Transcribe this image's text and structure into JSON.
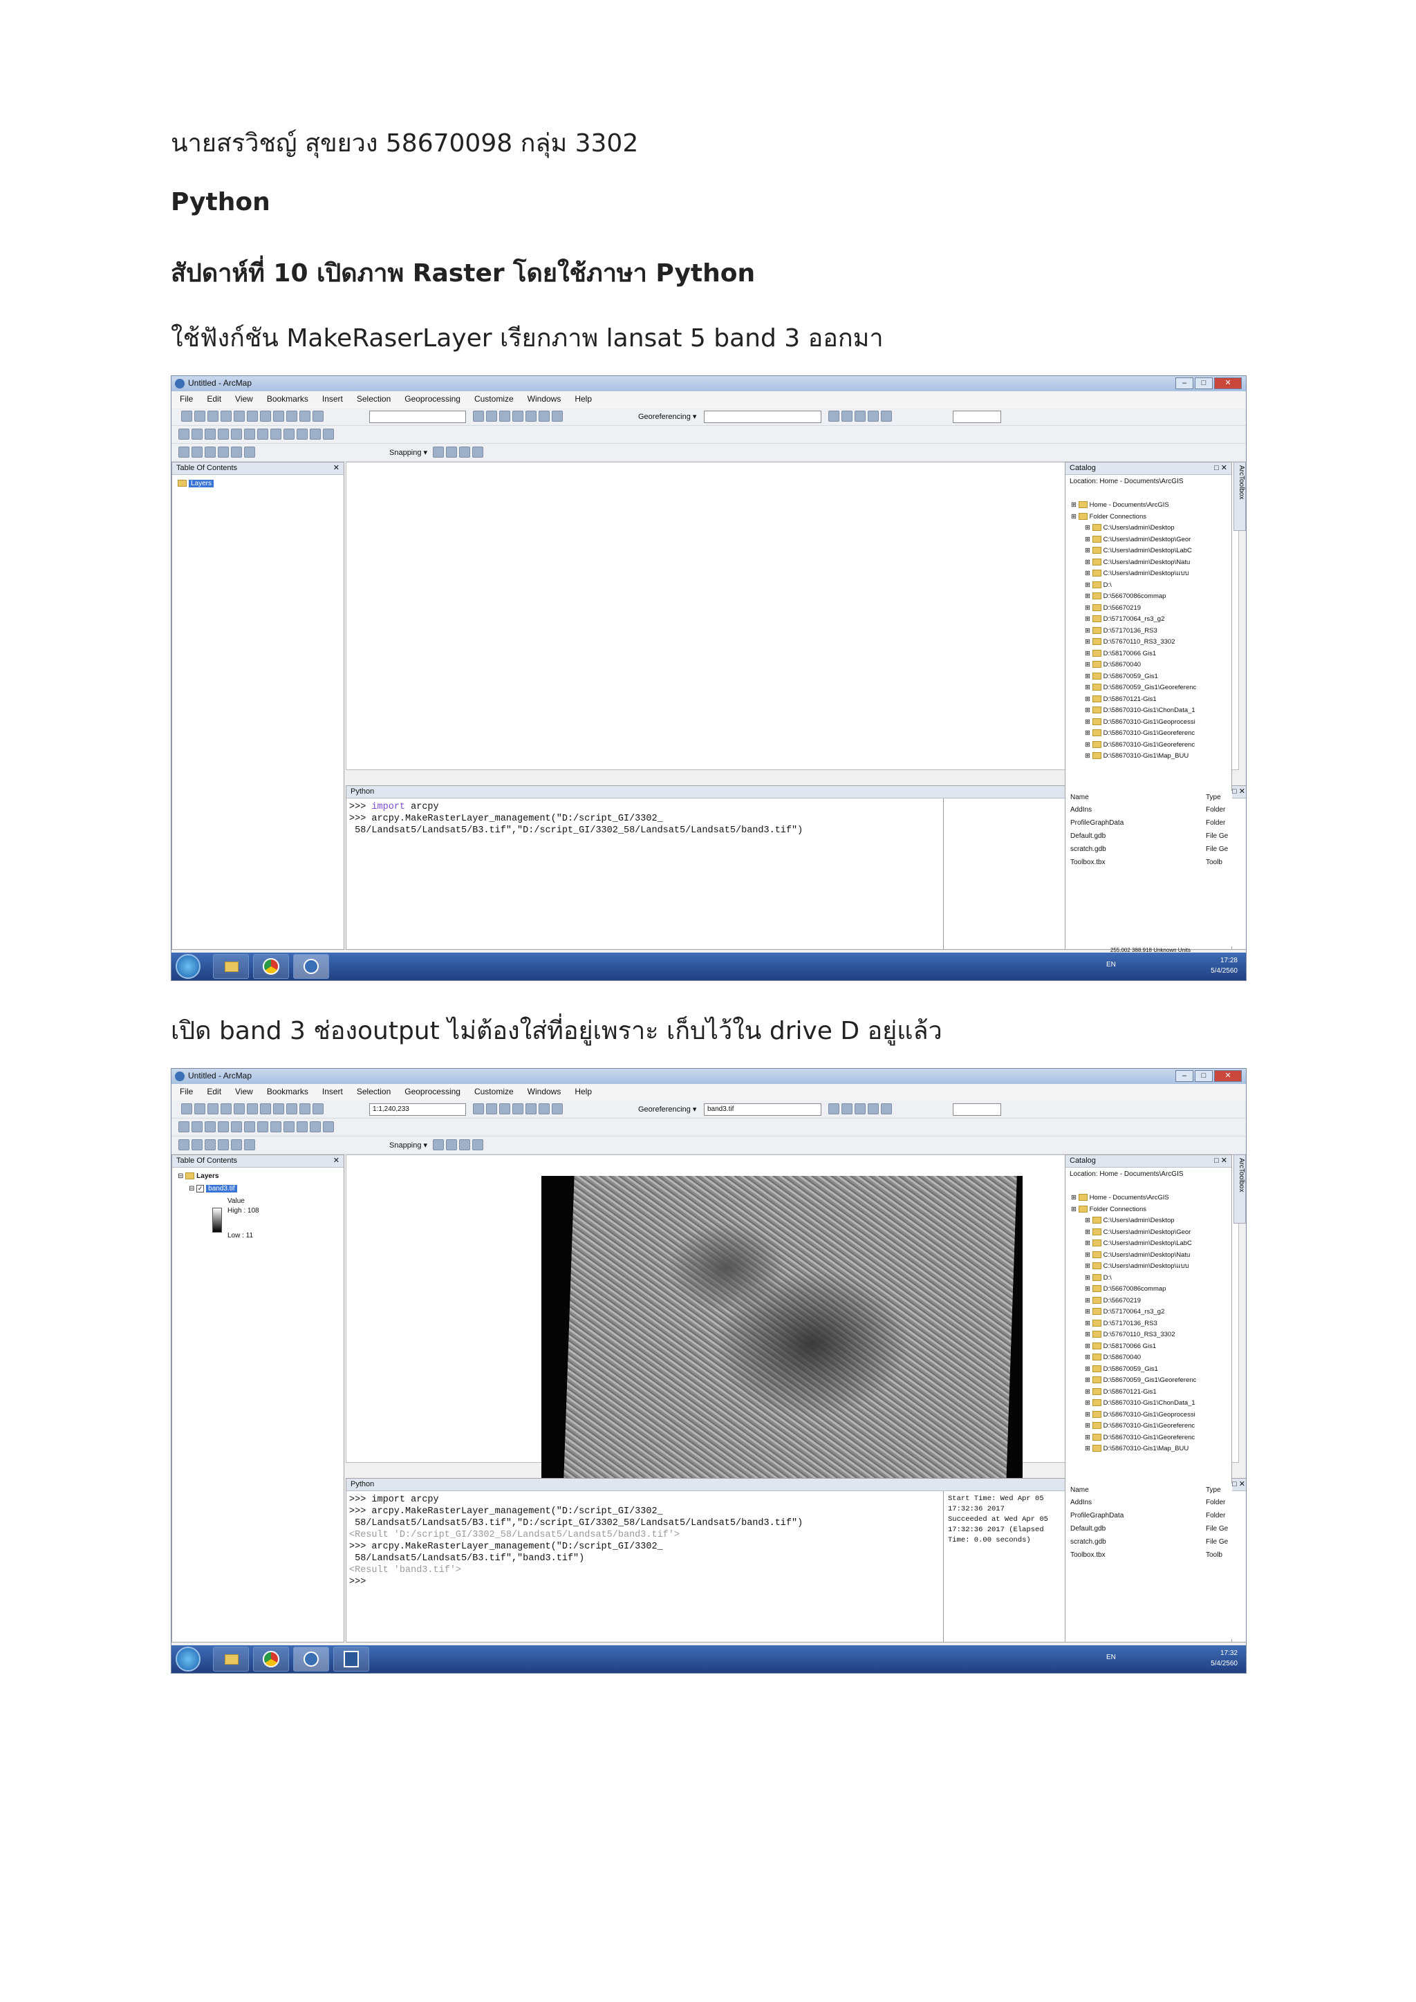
{
  "doc": {
    "line1": "นายสรวิชญ์ สุขยวง  58670098 กลุ่ม 3302",
    "line2": "Python",
    "line3": "สัปดาห์ที่ 10 เปิดภาพ Raster โดยใช้ภาษา Python",
    "line4": "ใช้ฟังก์ชัน MakeRaserLayer เรียกภาพ lansat 5 band 3 ออกมา",
    "line5": "เปิด band 3 ช่องoutput ไม่ต้องใส่ที่อยู่เพราะ เก็บไว้ใน drive D อยู่แล้ว"
  },
  "arcmap": {
    "title": "Untitled - ArcMap",
    "menu": [
      "File",
      "Edit",
      "View",
      "Bookmarks",
      "Insert",
      "Selection",
      "Geoprocessing",
      "Customize",
      "Windows",
      "Help"
    ],
    "georef_label": "Georeferencing ▾",
    "snapping_label": "Snapping ▾",
    "toc_title": "Table Of Contents",
    "layers_label": "Layers",
    "catalog_title": "Catalog",
    "location_label": "Location:",
    "location_value": "Home - Documents\\ArcGIS",
    "python_title": "Python",
    "toolbox_tab": "ArcToolbox",
    "catalog_tree": [
      "Home - Documents\\ArcGIS",
      "Folder Connections",
      "C:\\Users\\admin\\Desktop",
      "C:\\Users\\admin\\Desktop\\Geor",
      "C:\\Users\\admin\\Desktop\\LabC",
      "C:\\Users\\admin\\Desktop\\Natu",
      "C:\\Users\\admin\\Desktop\\แบบ",
      "D:\\",
      "D:\\56670086commap",
      "D:\\56670219",
      "D:\\57170064_rs3_g2",
      "D:\\57170136_RS3",
      "D:\\57670110_RS3_3302",
      "D:\\58170066 Gis1",
      "D:\\58670040",
      "D:\\58670059_Gis1",
      "D:\\58670059_Gis1\\Georeferenc",
      "D:\\58670121-Gis1",
      "D:\\58670310-Gis1\\ChonData_1",
      "D:\\58670310-Gis1\\Geoprocessi",
      "D:\\58670310-Gis1\\Georeferenc",
      "D:\\58670310-Gis1\\Georeferenc",
      "D:\\58670310-Gis1\\Map_BUU"
    ],
    "catalog_list_headers": [
      "Name",
      "Type"
    ],
    "catalog_list": [
      {
        "name": "AddIns",
        "type": "Folder"
      },
      {
        "name": "ProfileGraphData",
        "type": "Folder"
      },
      {
        "name": "Default.gdb",
        "type": "File Ge"
      },
      {
        "name": "scratch.gdb",
        "type": "File Ge"
      },
      {
        "name": "Toolbox.tbx",
        "type": "Toolb"
      }
    ],
    "taskbar_lang": "EN"
  },
  "shot1": {
    "code_line1_prompt": ">>> ",
    "code_line1_kw": "import",
    "code_line1_rest": " arcpy",
    "code_line2": ">>> arcpy.MakeRasterLayer_management(\"D:/script_GI/3302_",
    "code_line3": " 58/Landsat5/Landsat5/B3.tif\",\"D:/script_GI/3302_58/Landsat5/Landsat5/band3.tif\")",
    "status_text": "255.002  388.918 Unknown Units",
    "clock_time": "17:28",
    "clock_date": "5/4/2560"
  },
  "shot2": {
    "scale_value": "1:1,240,233",
    "georef_combo": "band3.tif",
    "layer_name": "band3.tif",
    "legend_value": "Value",
    "legend_high": "High : 108",
    "legend_low": "Low : 11",
    "code": [
      {
        "cls": "",
        "text": ">>> import arcpy"
      },
      {
        "cls": "",
        "text": ">>> arcpy.MakeRasterLayer_management(\"D:/script_GI/3302_"
      },
      {
        "cls": "",
        "text": " 58/Landsat5/Landsat5/B3.tif\",\"D:/script_GI/3302_58/Landsat5/Landsat5/band3.tif\")"
      },
      {
        "cls": "res",
        "text": "<Result 'D:/script_GI/3302_58/Landsat5/Landsat5/band3.tif'>"
      },
      {
        "cls": "",
        "text": ">>> arcpy.MakeRasterLayer_management(\"D:/script_GI/3302_"
      },
      {
        "cls": "",
        "text": " 58/Landsat5/Landsat5/B3.tif\",\"band3.tif\")"
      },
      {
        "cls": "res",
        "text": "<Result 'band3.tif'>"
      },
      {
        "cls": "",
        "text": ">>>"
      }
    ],
    "messages": [
      "Start Time: Wed Apr 05",
      "17:32:36 2017",
      "Succeeded at Wed Apr 05",
      "17:32:36 2017 (Elapsed",
      "Time: 0.00 seconds)"
    ],
    "clock_time": "17:32",
    "clock_date": "5/4/2560"
  }
}
